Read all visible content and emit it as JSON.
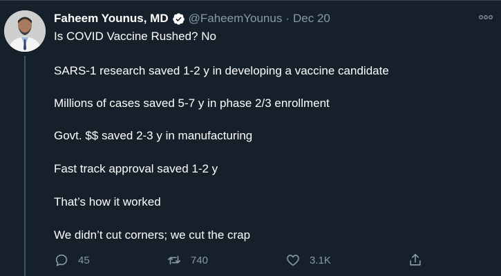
{
  "tweet": {
    "author_name": "Faheem Younus, MD",
    "handle": "@FaheemYounus",
    "separator": "·",
    "date": "Dec 20",
    "verified_icon": "verified-badge-icon",
    "more_icon": "more-options-icon",
    "avatar_icon": "author-avatar",
    "lines": [
      "Is COVID Vaccine Rushed? No",
      "SARS-1 research saved 1-2 y in developing a vaccine candidate",
      "Millions of cases saved 5-7 y in phase 2/3 enrollment",
      "Govt. $$ saved 2-3 y in manufacturing",
      "Fast track approval saved 1-2 y",
      "That’s how it worked",
      "We didn’t cut corners; we cut the crap"
    ],
    "actions": {
      "reply_count": "45",
      "retweet_count": "740",
      "like_count": "3.1K"
    }
  },
  "colors": {
    "background": "#15202b",
    "text": "#ffffff",
    "secondary": "#8899a6",
    "verified": "#ffffff"
  }
}
